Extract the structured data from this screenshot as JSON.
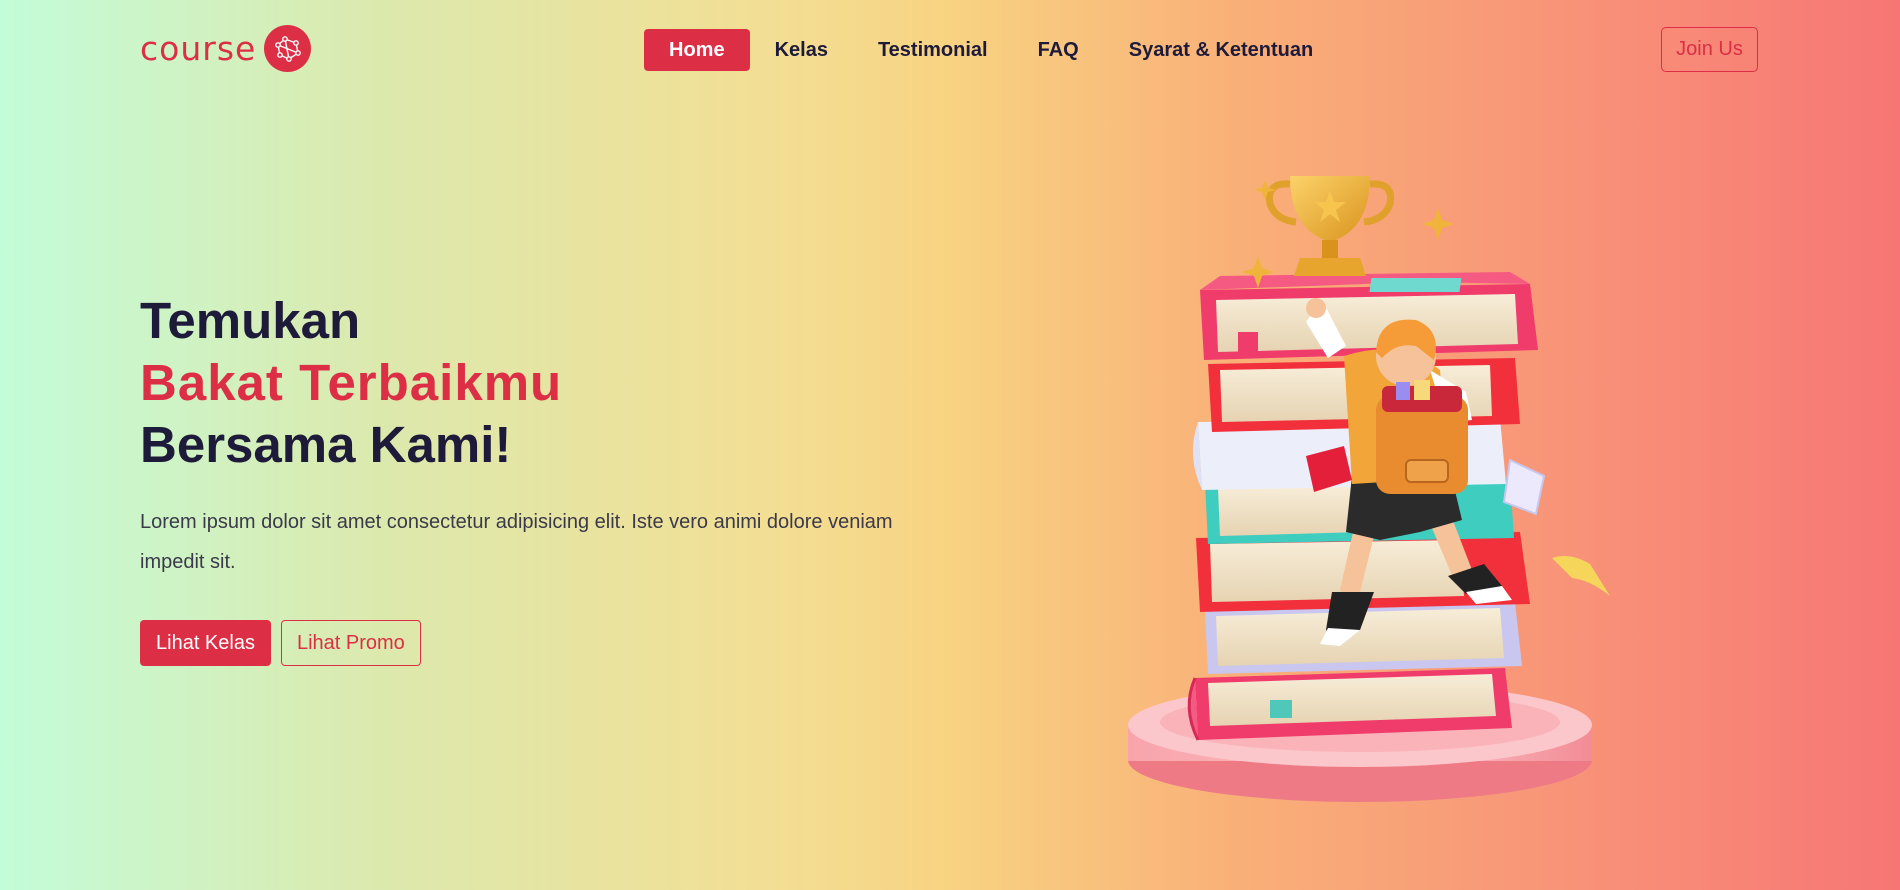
{
  "brand": {
    "name": "course",
    "logo_icon": "network-nodes-icon"
  },
  "nav": {
    "items": [
      {
        "label": "Home",
        "active": true
      },
      {
        "label": "Kelas",
        "active": false
      },
      {
        "label": "Testimonial",
        "active": false
      },
      {
        "label": "FAQ",
        "active": false
      },
      {
        "label": "Syarat & Ketentuan",
        "active": false
      }
    ],
    "join_label": "Join Us"
  },
  "hero": {
    "title_line1": "Temukan",
    "title_line2": "Bakat Terbaikmu",
    "title_line3": "Bersama Kami!",
    "description": "Lorem ipsum dolor sit amet consectetur adipisicing elit. Iste vero animi dolore veniam impedit sit.",
    "primary_button": "Lihat Kelas",
    "secondary_button": "Lihat Promo"
  },
  "illustration": {
    "subject": "student-climbing-book-stack-with-trophy"
  },
  "colors": {
    "accent": "#dc2f45",
    "text_dark": "#1e1b3a",
    "gradient_start": "#c3fcd9",
    "gradient_mid": "#f8d382",
    "gradient_end": "#f77675"
  }
}
